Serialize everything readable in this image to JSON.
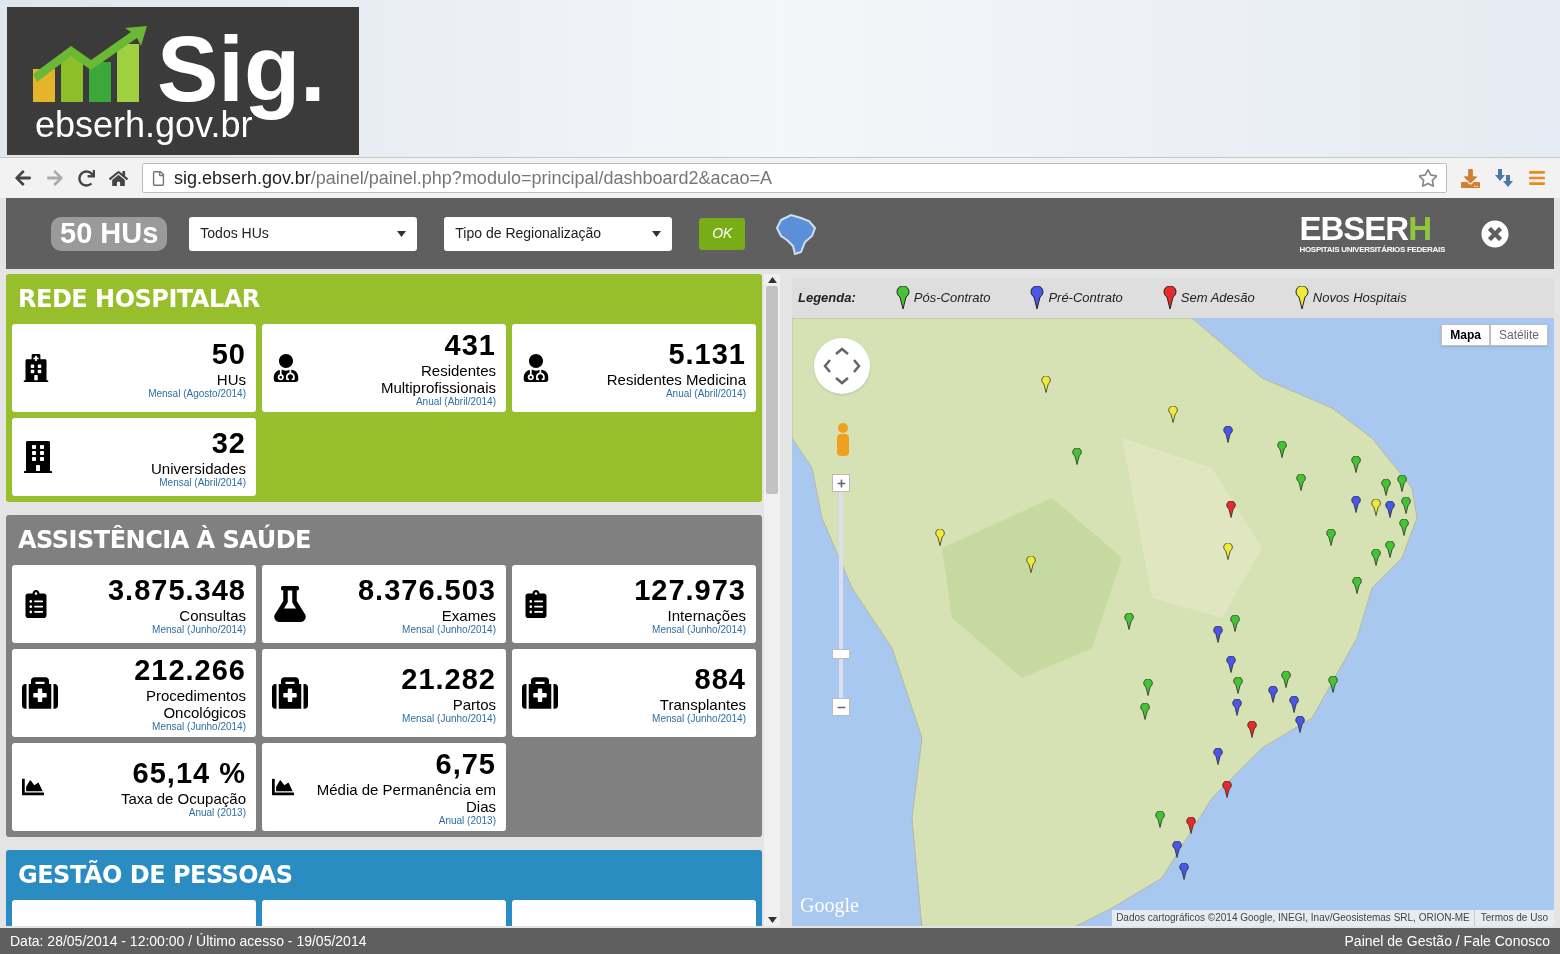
{
  "logo": {
    "brand": "Sig.",
    "domain": "ebserh.gov.br"
  },
  "browser": {
    "url_host": "sig.ebserh.gov.br",
    "url_path": "/painel/painel.php?modulo=principal/dashboard2&acao=A"
  },
  "header": {
    "count_badge": "50 HUs",
    "selects": [
      "Todos HUs",
      "Tipo de Regionalização"
    ],
    "ok_button": "OK",
    "brand_main": "EBSER",
    "brand_accent": "H",
    "brand_sub": "HOSPITAIS UNIVERSITÁRIOS FEDERAIS"
  },
  "sections": [
    {
      "title": "REDE HOSPITALAR",
      "color": "#96bf2b",
      "cards": [
        {
          "kind": "hospital",
          "value": "50",
          "label": "HUs",
          "period": "Mensal (Agosto/2014)"
        },
        {
          "kind": "doctor",
          "value": "431",
          "label": "Residentes Multiprofissionais",
          "period": "Anual (Abril/2014)"
        },
        {
          "kind": "doctor",
          "value": "5.131",
          "label": "Residentes Medicina",
          "period": "Anual (Abril/2014)"
        },
        {
          "kind": "building",
          "value": "32",
          "label": "Universidades",
          "period": "Mensal (Abril/2014)"
        }
      ]
    },
    {
      "title": "ASSISTÊNCIA À SAÚDE",
      "color": "#808080",
      "cards": [
        {
          "kind": "clipboard",
          "value": "3.875.348",
          "label": "Consultas",
          "period": "Mensal (Junho/2014)"
        },
        {
          "kind": "flask",
          "value": "8.376.503",
          "label": "Exames",
          "period": "Mensal (Junho/2014)"
        },
        {
          "kind": "clipboard",
          "value": "127.973",
          "label": "Internações",
          "period": "Mensal (Junho/2014)"
        },
        {
          "kind": "medkit",
          "value": "212.266",
          "label": "Procedimentos Oncológicos",
          "period": "Mensal (Junho/2014)"
        },
        {
          "kind": "medkit",
          "value": "21.282",
          "label": "Partos",
          "period": "Mensal (Junho/2014)"
        },
        {
          "kind": "medkit",
          "value": "884",
          "label": "Transplantes",
          "period": "Mensal (Junho/2014)"
        },
        {
          "kind": "chart",
          "value": "65,14 %",
          "label": "Taxa de Ocupação",
          "period": "Anual (2013)"
        },
        {
          "kind": "chart",
          "value": "6,75",
          "label": "Média de Permanência em Dias",
          "period": "Anual (2013)"
        }
      ]
    },
    {
      "title": "GESTÃO DE PESSOAS",
      "color": "#2a8cc0"
    }
  ],
  "legend": {
    "title": "Legenda:",
    "items": [
      {
        "label": "Pós-Contrato",
        "color": "#44c434"
      },
      {
        "label": "Pré-Contrato",
        "color": "#4a56e8"
      },
      {
        "label": "Sem Adesão",
        "color": "#e82a2a"
      },
      {
        "label": "Novos Hospitais",
        "color": "#eeea3a"
      }
    ]
  },
  "map": {
    "types": [
      {
        "label": "Mapa",
        "selected": true
      },
      {
        "label": "Satélite",
        "selected": false
      }
    ],
    "zoom": {
      "level": 0.2
    },
    "google_logo": "Google",
    "attribution": "Dados cartográficos ©2014 Google, INEGI, Inav/Geosistemas SRL, ORION-ME",
    "terms": "Termos de Uso",
    "markers": [
      {
        "color": "#eeea3a"
      },
      {
        "color": "#eeea3a"
      },
      {
        "color": "#4a56e8"
      },
      {
        "color": "#44c434"
      },
      {
        "color": "#44c434"
      },
      {
        "color": "#44c434"
      },
      {
        "color": "#44c434"
      },
      {
        "color": "#44c434"
      },
      {
        "color": "#44c434"
      },
      {
        "color": "#4a56e8"
      },
      {
        "color": "#eeea3a"
      },
      {
        "color": "#4a56e8"
      },
      {
        "color": "#44c434"
      },
      {
        "color": "#44c434"
      },
      {
        "color": "#e82a2a"
      },
      {
        "color": "#44c434"
      },
      {
        "color": "#44c434"
      },
      {
        "color": "#eeea3a"
      },
      {
        "color": "#eeea3a"
      },
      {
        "color": "#44c434"
      },
      {
        "color": "#eeea3a"
      },
      {
        "color": "#44c434"
      },
      {
        "color": "#44c434"
      },
      {
        "color": "#44c434"
      },
      {
        "color": "#4a56e8"
      },
      {
        "color": "#4a56e8"
      },
      {
        "color": "#44c434"
      },
      {
        "color": "#44c434"
      },
      {
        "color": "#44c434"
      },
      {
        "color": "#44c434"
      },
      {
        "color": "#4a56e8"
      },
      {
        "color": "#4a56e8"
      },
      {
        "color": "#4a56e8"
      },
      {
        "color": "#44c434"
      },
      {
        "color": "#4a56e8"
      },
      {
        "color": "#e82a2a"
      },
      {
        "color": "#4a56e8"
      },
      {
        "color": "#e82a2a"
      },
      {
        "color": "#44c434"
      },
      {
        "color": "#e82a2a"
      },
      {
        "color": "#4a56e8"
      },
      {
        "color": "#4a56e8"
      }
    ]
  },
  "status_bar": {
    "left": "Data: 28/05/2014 - 12:00:00 / Último acesso - 19/05/2014",
    "right": "Painel de Gestão / Fale Conosco"
  }
}
